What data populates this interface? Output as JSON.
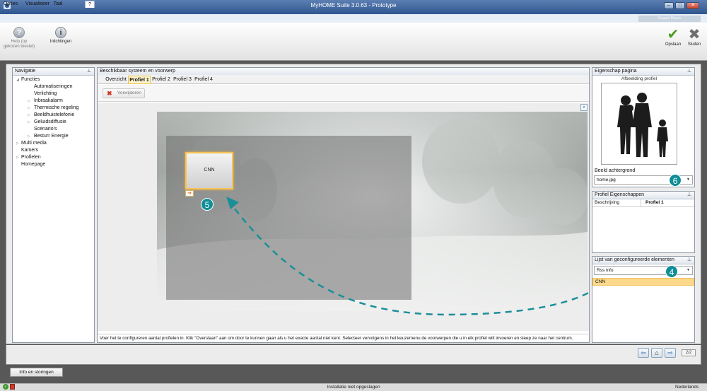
{
  "window": {
    "title": "MyHOME Suite 3.0.63 - Prototype",
    "min": "–",
    "max": "□",
    "close": "✕"
  },
  "menu": {
    "options": "Opties",
    "view": "Visualiseer",
    "language": "Taal",
    "help": "?"
  },
  "user_badge": "Elegant Mauve",
  "toolbar": {
    "help_label": "Help (op gekozen toestel)",
    "info_label": "Inlichtingen",
    "save_label": "Opslaan",
    "close_label": "Sluiten"
  },
  "navigation": {
    "title": "Navigatie",
    "items": [
      {
        "label": "Functies"
      },
      {
        "label": "Automatiseringen"
      },
      {
        "label": "Verlichting"
      },
      {
        "label": "Inbraakalarm"
      },
      {
        "label": "Thermische regeling"
      },
      {
        "label": "Beeldhuistelefonie"
      },
      {
        "label": "Geluidsdiffusie"
      },
      {
        "label": "Scenario's"
      },
      {
        "label": "Besturr Energie"
      },
      {
        "label": "Multi media"
      },
      {
        "label": "Kamers"
      },
      {
        "label": "Profielen"
      },
      {
        "label": "Homepage"
      }
    ]
  },
  "center": {
    "title": "Beschikbaar systeem en voorwerp",
    "tabs": [
      {
        "label": "Overzicht"
      },
      {
        "label": "Profiel 1"
      },
      {
        "label": "Profiel 2"
      },
      {
        "label": "Profiel 3"
      },
      {
        "label": "Profiel 4"
      }
    ],
    "remove_label": "Verwijderen",
    "widget_label": "CNN",
    "status_text": "Voer het te configureren aantal profielen in. Klik \"Overslaan\" aan om door te kunnen gaan als u het exacte aantal niet kent. Selecteer vervolgens in het keuzemenu de voorwerpen die u in elk profiel wilt invoeren en sleep ze naar het centrum."
  },
  "properties_page": {
    "title": "Eigenschap pagina",
    "image_label": "Afbeelding profiel",
    "bg_label": "Beeld achtergrond",
    "bg_value": "home.jpg"
  },
  "profile_properties": {
    "title": "Profiel Eigenschappen",
    "key": "Beschrijving",
    "value": "Profiel 1"
  },
  "configured_list": {
    "title": "Lijst van geconfigureerde elementen",
    "select_value": "Rss info",
    "item": "CNN"
  },
  "badges": {
    "b4": "4",
    "b5": "5",
    "b6": "6"
  },
  "pager": {
    "back": "⇦",
    "home": "⌂",
    "forward": "⇨",
    "page": "2/2"
  },
  "bottom_tab": "Info en storingen",
  "status": {
    "center": "Installatie niet opgeslagen",
    "language": "Nederlands"
  },
  "colors": {
    "accent": "#0f8e97",
    "selection": "#fdd98b",
    "title_bar": "#2f5690"
  }
}
